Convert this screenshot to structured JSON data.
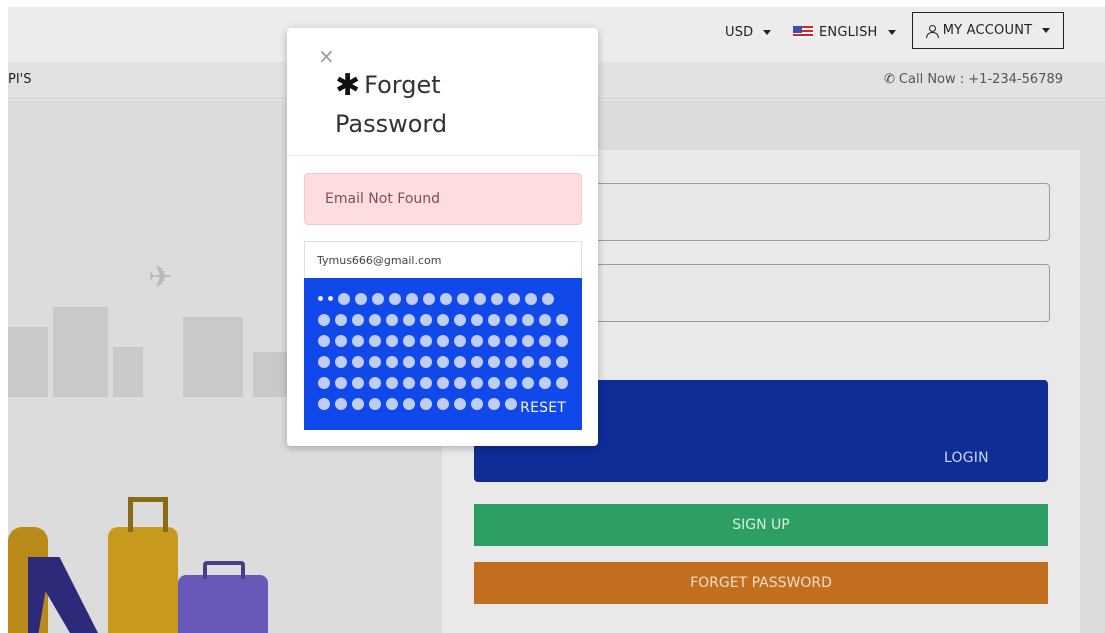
{
  "topbar": {
    "currency": "USD",
    "language": "ENGLISH",
    "account": "MY ACCOUNT"
  },
  "nav": {
    "left_text": "PI'S",
    "call_text": "Call Now : +1-234-56789"
  },
  "login_card": {
    "login_label": "LOGIN",
    "signup_label": "SIGN UP",
    "forget_label": "FORGET PASSWORD"
  },
  "modal": {
    "close_glyph": "×",
    "title_asterisk": "✱",
    "title": "Forget Password",
    "alert": "Email Not Found",
    "email_value": "Tymus666@gmail.com",
    "reset_label": "RESET"
  },
  "icons": {
    "close": "close-icon",
    "phone": "phone-icon",
    "person": "person-icon",
    "flag": "us-flag-icon",
    "asterisk": "asterisk-icon"
  },
  "colors": {
    "reset_button": "#1148ea",
    "login_button": "#0e2d96",
    "signup_button": "#2d9e64",
    "forget_button": "#c16f1f",
    "alert_bg": "#fddde0",
    "alert_text": "#8a4a52"
  }
}
